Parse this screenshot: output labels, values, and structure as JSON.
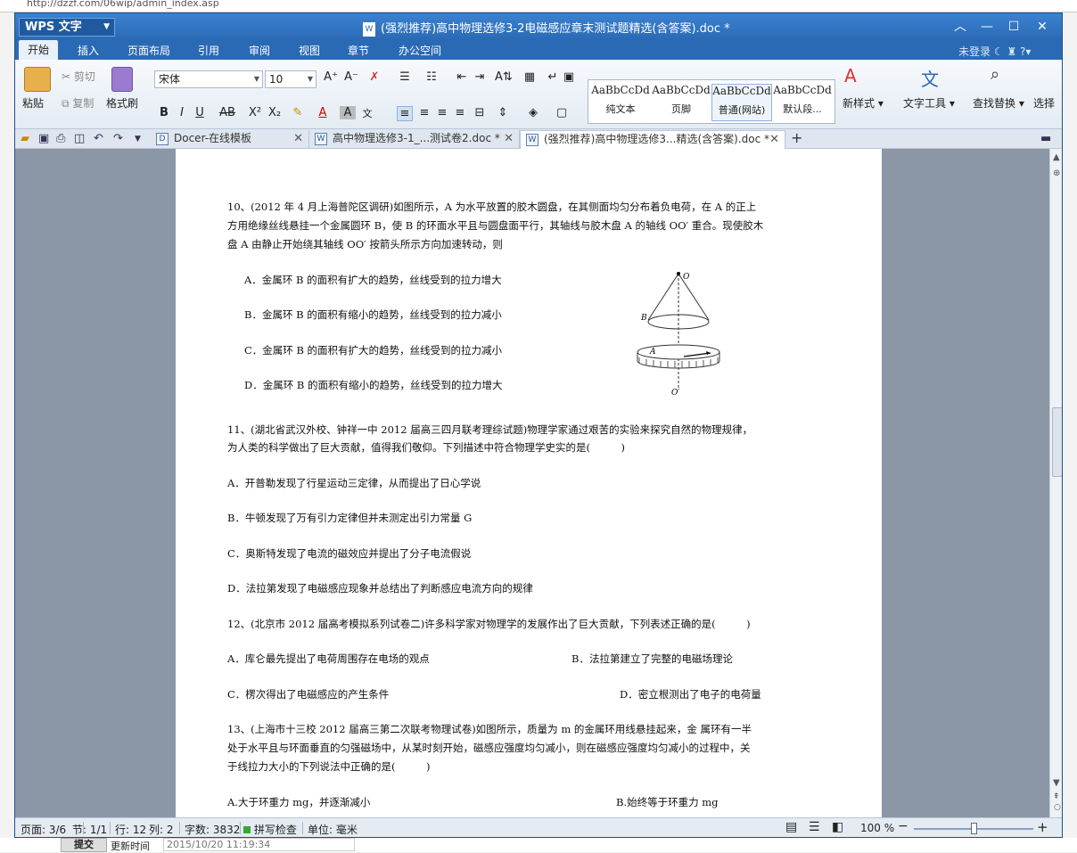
{
  "browser": {
    "url_fragment": "http://dzzf.com/06wip/admin_index.asp",
    "submit_label": "提交",
    "update_label": "更新时间",
    "update_value": "2015/10/20 11:19:34"
  },
  "app": {
    "name": "WPS 文字",
    "title": "(强烈推荐)高中物理选修3-2电磁感应章末测试题精选(含答案).doc *"
  },
  "menu": {
    "items": [
      "开始",
      "插入",
      "页面布局",
      "引用",
      "审阅",
      "视图",
      "章节",
      "办公空间"
    ],
    "login": "未登录"
  },
  "ribbon": {
    "paste": "粘贴",
    "cut": "剪切",
    "copy": "复制",
    "format_painter": "格式刷",
    "font": "宋体",
    "font_size": "10",
    "styles": [
      {
        "preview": "AaBbCcDd",
        "label": "纯文本"
      },
      {
        "preview": "AaBbCcDd",
        "label": "页脚"
      },
      {
        "preview": "AaBbCcDd",
        "label": "普通(网站)"
      },
      {
        "preview": "AaBbCcDd",
        "label": "默认段..."
      }
    ],
    "new_style": "新样式",
    "text_tools": "文字工具",
    "find_replace": "查找替换",
    "select": "选择"
  },
  "tabs": [
    {
      "label": "Docer-在线模板"
    },
    {
      "label": "高中物理选修3-1_...测试卷2.doc *"
    },
    {
      "label": "(强烈推荐)高中物理选修3...精选(含答案).doc *"
    }
  ],
  "doc": {
    "q10_l1": "10、(2012 年 4 月上海普陀区调研)如图所示，A 为水平放置的胶木圆盘，在其侧面均匀分布着负电荷，在 A 的正上",
    "q10_l2": "方用绝缘丝线悬挂一个金属圆环 B，使 B 的环面水平且与圆盘面平行，其轴线与胶木盘 A 的轴线 OO′ 重合。现使胶木",
    "q10_l3": "盘 A 由静止开始绕其轴线 OO′ 按箭头所示方向加速转动，则",
    "q10_a": "A．金属环 B 的面积有扩大的趋势，丝线受到的拉力增大",
    "q10_b": "B．金属环 B 的面积有缩小的趋势，丝线受到的拉力减小",
    "q10_c": "C．金属环 B 的面积有扩大的趋势，丝线受到的拉力减小",
    "q10_d": "D．金属环 B 的面积有缩小的趋势，丝线受到的拉力增大",
    "fig_o": "O",
    "fig_b": "B",
    "fig_a": "A",
    "fig_o2": "O′",
    "q11_l1": "11、(湖北省武汉外校、钟祥一中 2012 届高三四月联考理综试题)物理学家通过艰苦的实验来探究自然的物理规律，",
    "q11_l2": "为人类的科学做出了巨大贡献，值得我们敬仰。下列描述中符合物理学史实的是(　　　)",
    "q11_a": "A．开普勒发现了行星运动三定律，从而提出了日心学说",
    "q11_b": "B．牛顿发现了万有引力定律但并未测定出引力常量 G",
    "q11_c": "C．奥斯特发现了电流的磁效应并提出了分子电流假说",
    "q11_d": "D．法拉第发现了电磁感应现象并总结出了判断感应电流方向的规律",
    "q12_l1": "12、(北京市 2012 届高考模拟系列试卷二)许多科学家对物理学的发展作出了巨大贡献，下列表述正确的是(　　　)",
    "q12_a": "A．库仑最先提出了电荷周围存在电场的观点",
    "q12_b": "B．法拉第建立了完整的电磁场理论",
    "q12_c": "C．楞次得出了电磁感应的产生条件",
    "q12_d": "D．密立根测出了电子的电荷量",
    "q13_l1": "13、(上海市十三校 2012 届高三第二次联考物理试卷)如图所示，质量为 m 的金属环用线悬挂起来，金 属环有一半",
    "q13_l2": "处于水平且与环面垂直的匀强磁场中，从某时刻开始，磁感应强度均匀减小，则在磁感应强度均匀减小的过程中，关",
    "q13_l3": "于线拉力大小的下列说法中正确的是(　　　)",
    "q13_a": "A.大于环重力 mg，并逐渐减小",
    "q13_b": "B.始终等于环重力 mg"
  },
  "status": {
    "page": "页面: 3/6",
    "section": "节: 1/1",
    "row": "行: 12",
    "col": "列: 2",
    "words": "字数: 3832",
    "spell": "拼写检查",
    "unit": "单位: 毫米",
    "zoom": "100 %",
    "zoom_level": 100
  },
  "colors": {
    "title_blue": "#2a6ab5",
    "accent": "#3b82d0",
    "workspace": "#8b97a6"
  }
}
